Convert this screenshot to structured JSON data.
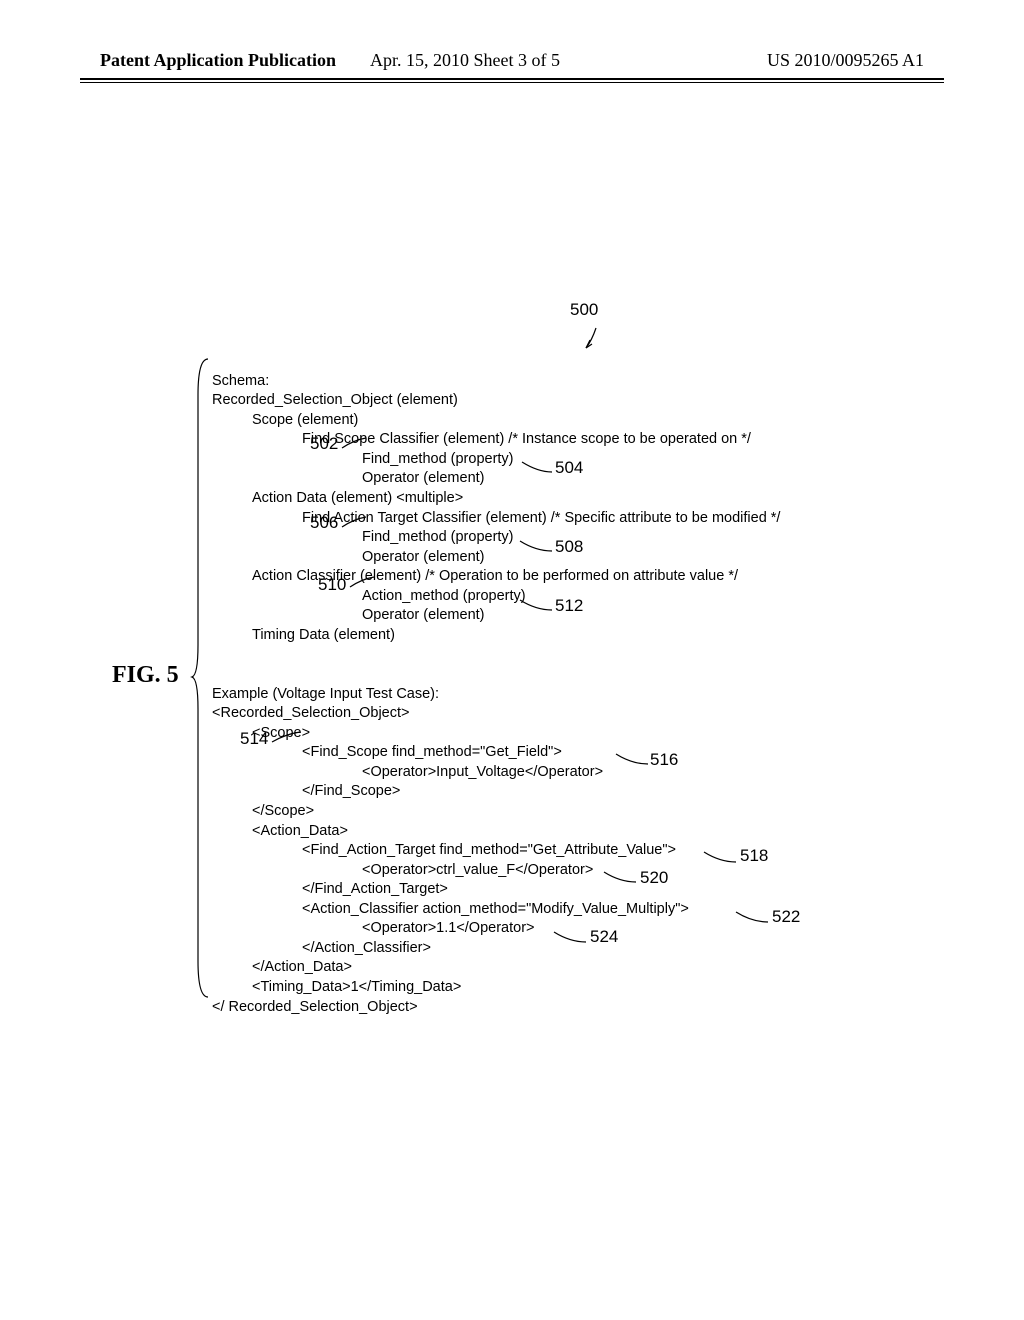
{
  "header": {
    "left": "Patent Application Publication",
    "mid": "Apr. 15, 2010  Sheet 3 of 5",
    "right": "US 2010/0095265 A1"
  },
  "figure_label": "FIG. 5",
  "ref500": "500",
  "schema": {
    "title": "Schema:",
    "l1": "Recorded_Selection_Object (element)",
    "l2": "Scope (element)",
    "l3": "Find Scope Classifier (element) /* Instance scope to be operated on */",
    "l4": "Find_method (property)",
    "l5": "Operator (element)",
    "l6": "Action Data (element) <multiple>",
    "l7": "Find Action Target Classifier (element) /* Specific attribute to be modified */",
    "l8": "Find_method (property)",
    "l9": "Operator (element)",
    "l10": "Action Classifier (element) /* Operation to be performed on attribute value */",
    "l11": "Action_method (property)",
    "l12": "Operator (element)",
    "l13": "Timing Data (element)"
  },
  "example": {
    "title": "Example (Voltage Input Test Case):",
    "x1": "<Recorded_Selection_Object>",
    "x2": "<Scope>",
    "x3": "<Find_Scope find_method=\"Get_Field\">",
    "x4": "<Operator>Input_Voltage</Operator>",
    "x5": "</Find_Scope>",
    "x6": "</Scope>",
    "x7": "<Action_Data>",
    "x8": "<Find_Action_Target find_method=\"Get_Attribute_Value\">",
    "x9": "<Operator>ctrl_value_F</Operator>",
    "x10": "</Find_Action_Target>",
    "x11": "<Action_Classifier action_method=\"Modify_Value_Multiply\">",
    "x12": "<Operator>1.1</Operator>",
    "x13": "</Action_Classifier>",
    "x14": "</Action_Data>",
    "x15": "<Timing_Data>1</Timing_Data>",
    "x16": "</ Recorded_Selection_Object>"
  },
  "callouts": {
    "c502": "502",
    "c504": "504",
    "c506": "506",
    "c508": "508",
    "c510": "510",
    "c512": "512",
    "c514": "514",
    "c516": "516",
    "c518": "518",
    "c520": "520",
    "c522": "522",
    "c524": "524"
  }
}
